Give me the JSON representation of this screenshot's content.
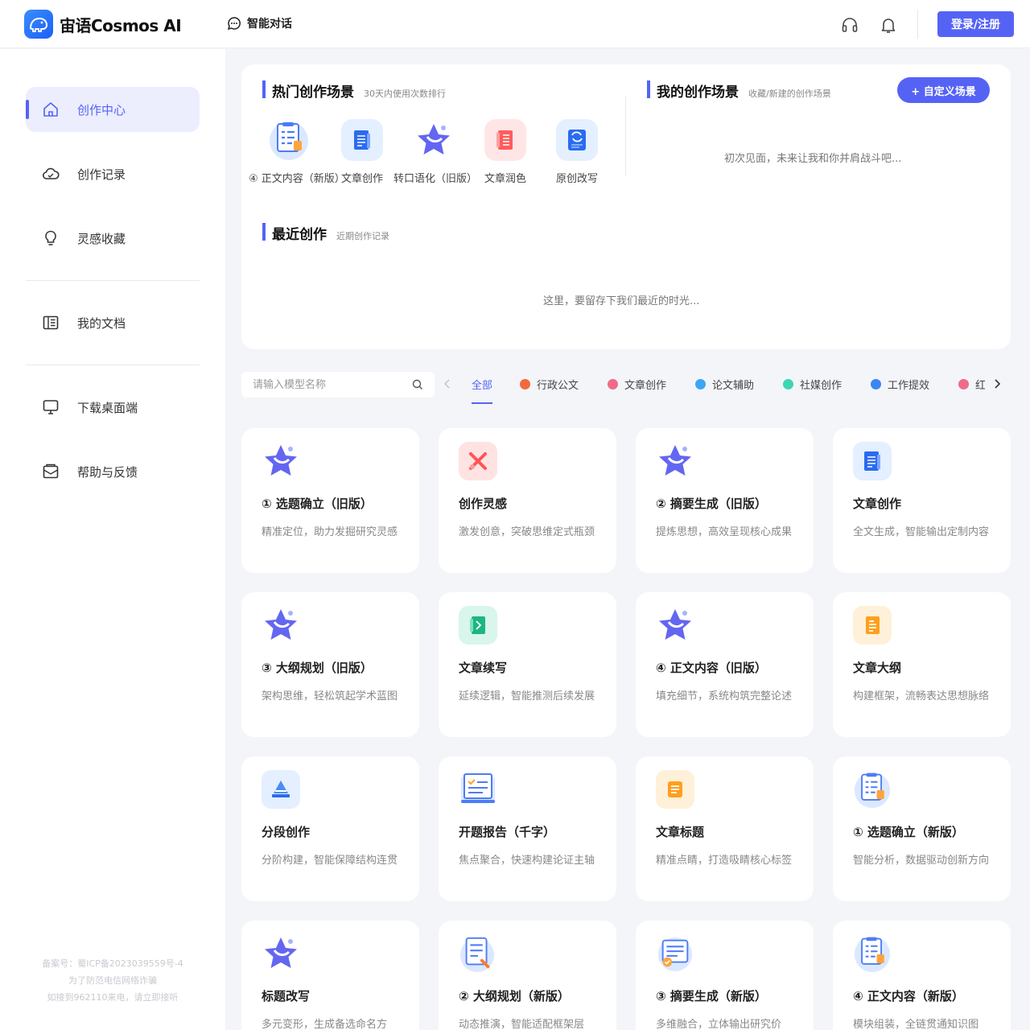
{
  "header": {
    "brand": "宙语Cosmos AI",
    "nav_chat": "智能对话",
    "login": "登录/注册"
  },
  "sidebar": {
    "items": [
      {
        "label": "创作中心",
        "icon": "home-icon",
        "active": true
      },
      {
        "label": "创作记录",
        "icon": "cloud-icon"
      },
      {
        "label": "灵感收藏",
        "icon": "lightbulb-icon"
      },
      {
        "label": "我的文档",
        "icon": "book-icon"
      },
      {
        "label": "下载桌面端",
        "icon": "monitor-icon"
      },
      {
        "label": "帮助与反馈",
        "icon": "mail-icon"
      }
    ],
    "footer": [
      "备案号：蜀ICP备2023039559号-4",
      "为了防范电信网络诈骗",
      "如接到962110来电，请立即接听"
    ]
  },
  "hot": {
    "title": "热门创作场景",
    "subtitle": "30天内使用次数排行",
    "items": [
      {
        "label": "④ 正文内容（新版）",
        "icon": "checklist-icon"
      },
      {
        "label": "文章创作",
        "icon": "document-icon"
      },
      {
        "label": "转口语化（旧版）",
        "icon": "star-icon"
      },
      {
        "label": "文章润色",
        "icon": "notebook-icon"
      },
      {
        "label": "原创改写",
        "icon": "rewrite-icon"
      }
    ]
  },
  "mine": {
    "title": "我的创作场景",
    "subtitle": "收藏/新建的创作场景",
    "custom_button": "+ 自定义场景",
    "empty": "初次见面，未来让我和你并肩战斗吧..."
  },
  "recent": {
    "title": "最近创作",
    "subtitle": "近期创作记录",
    "empty": "这里，要留存下我们最近的时光..."
  },
  "search": {
    "placeholder": "请输入模型名称"
  },
  "tabs": [
    {
      "label": "全部",
      "color": ""
    },
    {
      "label": "行政公文",
      "color": "#f26a3d"
    },
    {
      "label": "文章创作",
      "color": "#f06b8a"
    },
    {
      "label": "论文辅助",
      "color": "#3aa6f5"
    },
    {
      "label": "社媒创作",
      "color": "#3ed6b0"
    },
    {
      "label": "工作提效",
      "color": "#3b86f0"
    },
    {
      "label": "红",
      "color": "#f06b8a"
    }
  ],
  "cards": [
    {
      "title": "① 选题确立（旧版）",
      "desc": "精准定位，助力发掘研究灵感",
      "icon": "star-icon"
    },
    {
      "title": "创作灵感",
      "desc": "激发创意，突破思维定式瓶颈",
      "icon": "tools-icon"
    },
    {
      "title": "② 摘要生成（旧版）",
      "desc": "提炼思想，高效呈现核心成果",
      "icon": "star-icon"
    },
    {
      "title": "文章创作",
      "desc": "全文生成，智能输出定制内容",
      "icon": "document-icon"
    },
    {
      "title": "③ 大纲规划（旧版）",
      "desc": "架构思维，轻松筑起学术蓝图",
      "icon": "star-icon"
    },
    {
      "title": "文章续写",
      "desc": "延续逻辑，智能推测后续发展",
      "icon": "notebook-green-icon"
    },
    {
      "title": "④ 正文内容（旧版）",
      "desc": "填充细节，系统构筑完整论述",
      "icon": "star-icon"
    },
    {
      "title": "文章大纲",
      "desc": "构建框架，流畅表达思想脉络",
      "icon": "outline-icon"
    },
    {
      "title": "分段创作",
      "desc": "分阶构建，智能保障结构连贯",
      "icon": "layers-icon"
    },
    {
      "title": "开题报告（千字）",
      "desc": "焦点聚合，快速构建论证主轴",
      "icon": "report-icon"
    },
    {
      "title": "文章标题",
      "desc": "精准点睛，打造吸睛核心标签",
      "icon": "title-icon"
    },
    {
      "title": "① 选题确立（新版）",
      "desc": "智能分析，数据驱动创新方向",
      "icon": "checklist-icon"
    },
    {
      "title": "标题改写",
      "desc": "多元变形，生成备选命名方",
      "icon": "star-icon"
    },
    {
      "title": "② 大纲规划（新版）",
      "desc": "动态推演，智能适配框架层",
      "icon": "edit-doc-icon"
    },
    {
      "title": "③ 摘要生成（新版）",
      "desc": "多维融合，立体输出研究价",
      "icon": "summary-icon"
    },
    {
      "title": "④ 正文内容（新版）",
      "desc": "模块组装，全链贯通知识图",
      "icon": "checklist-icon"
    }
  ]
}
